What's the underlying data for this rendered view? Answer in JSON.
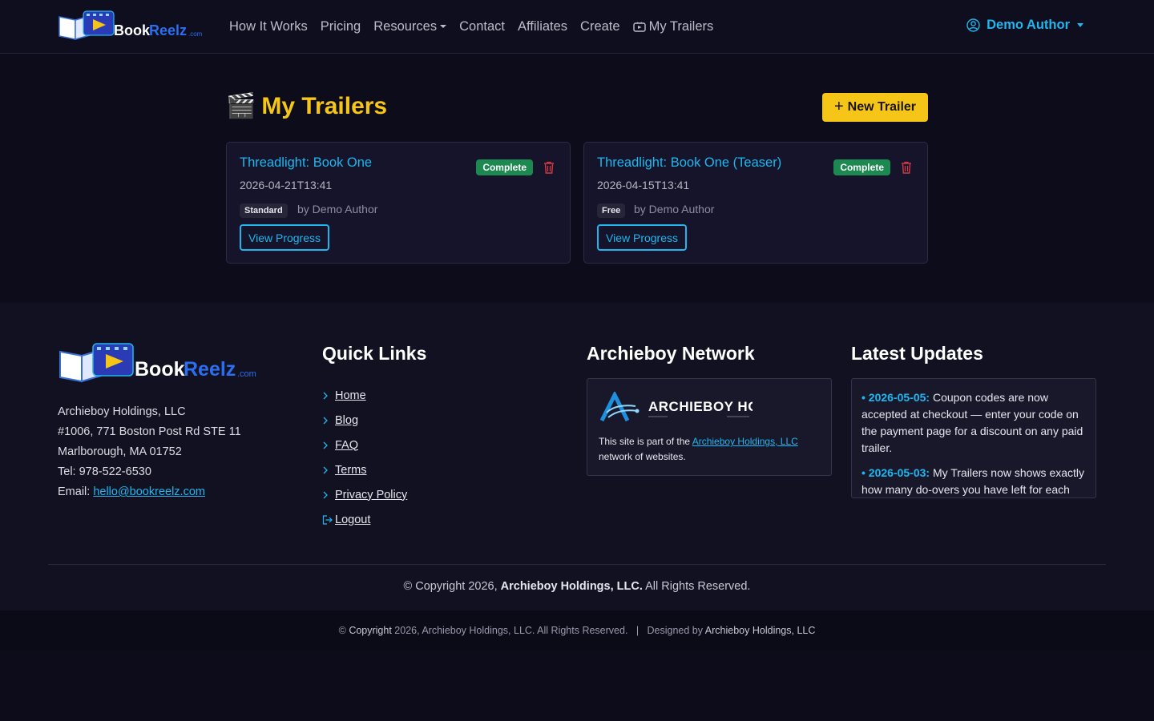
{
  "brand": {
    "logo_text": "BookReelz.com"
  },
  "nav": {
    "links": [
      "How It Works",
      "Pricing",
      "Resources",
      "Contact",
      "Affiliates",
      "Create",
      "My Trailers"
    ],
    "user": "Demo Author"
  },
  "main": {
    "title": "My Trailers",
    "new_trailer": "New Trailer",
    "cards": [
      {
        "title": "Threadlight: Book One",
        "status": "Complete",
        "date": "2026-04-21T13:41",
        "plan": "Standard",
        "author": "by Demo Author",
        "button": "View Progress"
      },
      {
        "title": "Threadlight: Book One (Teaser)",
        "status": "Complete",
        "date": "2026-04-15T13:41",
        "plan": "Free",
        "author": "by Demo Author",
        "button": "View Progress"
      }
    ]
  },
  "footer": {
    "address": {
      "company": "Archieboy Holdings, LLC",
      "line1": "#1006, 771 Boston Post Rd STE 11",
      "line2": "Marlborough, MA 01752",
      "tel": "Tel: 978-522-6530",
      "email_label": "Email:",
      "email": "hello@bookreelz.com"
    },
    "quick_links": {
      "heading": "Quick Links",
      "items": [
        "Home",
        "Blog",
        "FAQ",
        "Terms",
        "Privacy Policy"
      ],
      "logout": "Logout"
    },
    "network": {
      "heading": "Archieboy Network",
      "logo_text": "ARCHIEBOY HOLDINGS, LLC",
      "text_before": "This site is part of the ",
      "link": "Archieboy Holdings, LLC",
      "text_after": " network of websites."
    },
    "updates": {
      "heading": "Latest Updates",
      "items": [
        {
          "date": "2026-05-05:",
          "text": " Coupon codes are now accepted at checkout — enter your code on the payment page for a discount on any paid trailer."
        },
        {
          "date": "2026-05-03:",
          "text": " My Trailers now shows exactly how many do-overs you have left for each trailer."
        }
      ]
    },
    "copyright": {
      "before": "© Copyright 2026, ",
      "company": "Archieboy Holdings, LLC.",
      "after": " All Rights Reserved."
    },
    "bottom": {
      "copyright_word": "Copyright",
      "copyright_rest": " 2026, Archieboy Holdings, LLC. All Rights Reserved.",
      "designed_by": "Designed by ",
      "designer": "Archieboy Holdings, LLC"
    }
  },
  "colors": {
    "accent": "#1fb7f0",
    "brand_yellow": "#f5c518",
    "status_green": "#1c8a50",
    "background": "#0d0c1b"
  },
  "icons": [
    "book-reel-logo",
    "tv-icon",
    "user-circle-icon",
    "clapperboard-icon",
    "plus-icon",
    "trash-icon",
    "chevron-right-icon",
    "logout-icon",
    "archieboy-logo"
  ]
}
